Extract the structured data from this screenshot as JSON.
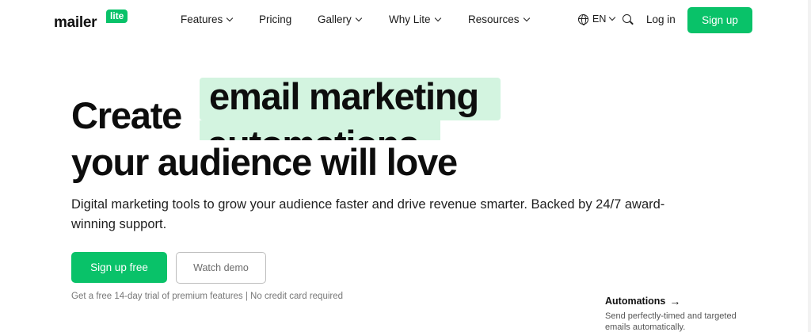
{
  "brand": {
    "wordmark": "mailer",
    "badge": "lite",
    "accent_color": "#09c269",
    "highlight_color": "#d3f4e0"
  },
  "nav": {
    "items": [
      {
        "label": "Features",
        "has_dropdown": true,
        "icon": "chevron-down-icon"
      },
      {
        "label": "Pricing",
        "has_dropdown": false
      },
      {
        "label": "Gallery",
        "has_dropdown": true,
        "icon": "chevron-down-icon"
      },
      {
        "label": "Why Lite",
        "has_dropdown": true,
        "icon": "chevron-down-icon"
      },
      {
        "label": "Resources",
        "has_dropdown": true,
        "icon": "chevron-down-icon"
      }
    ],
    "language": {
      "label": "EN",
      "icon": "globe-icon"
    },
    "search_icon": "search-icon",
    "login_label": "Log in",
    "signup_label": "Sign up"
  },
  "hero": {
    "line1_prefix": "Create",
    "rotating_phrase_line1": "email marketing",
    "rotating_phrase_line2": "automations",
    "line2": "your audience will love",
    "subtitle": "Digital marketing tools to grow your audience faster and drive revenue smarter. Backed by 24/7 award-winning support.",
    "primary_button": "Sign up free",
    "secondary_button": "Watch demo",
    "trial_note": "Get a free 14-day trial of premium features | No credit card required"
  },
  "feature_card": {
    "title": "Automations",
    "arrow": "→",
    "description": "Send perfectly-timed and targeted emails automatically."
  }
}
